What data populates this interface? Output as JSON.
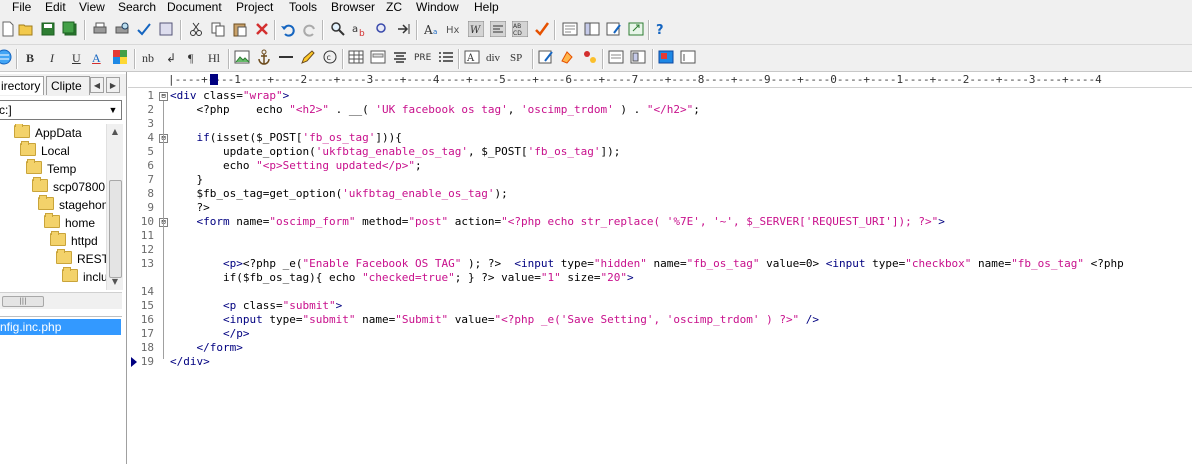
{
  "menu": [
    "File",
    "Edit",
    "View",
    "Search",
    "Document",
    "Project",
    "Tools",
    "Browser",
    "ZC",
    "Window",
    "Help"
  ],
  "toolbar1": [
    "new-file-icon",
    "open-folder-icon",
    "save-icon",
    "save-all-icon",
    "print-icon",
    "print-preview-icon",
    "spellcheck-icon",
    "find-in-files-icon",
    "cut-icon",
    "copy-icon",
    "paste-icon",
    "delete-icon",
    "undo-icon",
    "redo-icon",
    "find-icon",
    "replace-icon",
    "find-next-icon",
    "goto-line-icon",
    "font-size-icon",
    "hex-icon",
    "word-wrap-icon",
    "show-whitespace-icon",
    "line-numbers-icon",
    "syntax-check-icon",
    "browser-preview-icon",
    "toggle-panel-icon",
    "edit-template-icon",
    "external-preview-icon",
    "help-query-icon"
  ],
  "toolbar2": {
    "icons": [
      "globe-icon",
      "image-icon",
      "anchor-icon",
      "hr-icon",
      "pencil-icon",
      "copyright-icon",
      "table-icon",
      "form-icon",
      "align-icon",
      "tag-edit-icon",
      "tag-clear-icon",
      "color-picker-icon",
      "list-view-icon",
      "grid-view-icon",
      "insert-frame-icon",
      "object-icon"
    ],
    "labels": {
      "bold": "B",
      "italic": "I",
      "underline": "U",
      "font": "A",
      "nbsp": "nb",
      "br": "↲",
      "para": "¶",
      "heading": "Hl",
      "pre": "PRE",
      "div": "div",
      "span": "SP"
    }
  },
  "left_panel": {
    "tabs": [
      "irectory",
      "Clipte"
    ],
    "drive": "c:]",
    "tree": [
      {
        "label": "AppData",
        "indent": 14
      },
      {
        "label": "Local",
        "indent": 20
      },
      {
        "label": "Temp",
        "indent": 26
      },
      {
        "label": "scp07800",
        "indent": 32
      },
      {
        "label": "stagehom",
        "indent": 38
      },
      {
        "label": "home",
        "indent": 44
      },
      {
        "label": "httpd",
        "indent": 50
      },
      {
        "label": "RESTVI",
        "indent": 56
      },
      {
        "label": "incluc",
        "indent": 62
      }
    ],
    "hscroll_thumb": "|||",
    "selected_file": "nfig.inc.php"
  },
  "editor": {
    "ruler": "|----+----1----+----2----+----3----+----4----+----5----+----6----+----7----+----8----+----9----+----0----+----1----+----2----+----3----+----4",
    "lines": [
      {
        "n": "1",
        "fold": "⊟",
        "parts": [
          [
            "k",
            "<div "
          ],
          [
            "",
            "class="
          ],
          [
            "s",
            "\"wrap\""
          ],
          [
            "k",
            ">"
          ]
        ]
      },
      {
        "n": "2",
        "fold": "",
        "parts": [
          [
            "",
            "    <?php    echo "
          ],
          [
            "s",
            "\"<h2>\""
          ],
          [
            "",
            " . __( "
          ],
          [
            "s",
            "'UK facebook os tag'"
          ],
          [
            "",
            ", "
          ],
          [
            "s",
            "'oscimp_trdom'"
          ],
          [
            "",
            " ) . "
          ],
          [
            "s",
            "\"</h2>\""
          ],
          [
            "",
            ";"
          ]
        ]
      },
      {
        "n": "3",
        "fold": "",
        "parts": []
      },
      {
        "n": "4",
        "fold": "⊟",
        "parts": [
          [
            "",
            "    "
          ],
          [
            "k",
            "if"
          ],
          [
            "",
            "(isset($_POST["
          ],
          [
            "s",
            "'fb_os_tag'"
          ],
          [
            "",
            "])){"
          ]
        ]
      },
      {
        "n": "5",
        "fold": "",
        "parts": [
          [
            "",
            "        update_option("
          ],
          [
            "s",
            "'ukfbtag_enable_os_tag'"
          ],
          [
            "",
            ", $_POST["
          ],
          [
            "s",
            "'fb_os_tag'"
          ],
          [
            "",
            "]);"
          ]
        ]
      },
      {
        "n": "6",
        "fold": "",
        "parts": [
          [
            "",
            "        echo "
          ],
          [
            "s",
            "\"<p>Setting updated</p>\""
          ],
          [
            "",
            ";"
          ]
        ]
      },
      {
        "n": "7",
        "fold": "",
        "parts": [
          [
            "",
            "    }"
          ]
        ]
      },
      {
        "n": "8",
        "fold": "",
        "parts": [
          [
            "",
            "    $fb_os_tag=get_option("
          ],
          [
            "s",
            "'ukfbtag_enable_os_tag'"
          ],
          [
            "",
            ");"
          ]
        ]
      },
      {
        "n": "9",
        "fold": "",
        "parts": [
          [
            "",
            "    ?>"
          ]
        ]
      },
      {
        "n": "10",
        "fold": "⊟",
        "parts": [
          [
            "k",
            "    <form "
          ],
          [
            "",
            "name="
          ],
          [
            "s",
            "\"oscimp_form\""
          ],
          [
            "",
            " method="
          ],
          [
            "s",
            "\"post\""
          ],
          [
            "",
            " action="
          ],
          [
            "s",
            "\"<?php echo str_replace( '%7E', '~', $_SERVER['REQUEST_URI']); ?>\""
          ],
          [
            "k",
            ">"
          ]
        ]
      },
      {
        "n": "11",
        "fold": "",
        "parts": []
      },
      {
        "n": "12",
        "fold": "",
        "parts": []
      },
      {
        "n": "13",
        "fold": "",
        "parts": [
          [
            "k",
            "        <p>"
          ],
          [
            "",
            "<?php _e("
          ],
          [
            "s",
            "\"Enable Facebook OS TAG\""
          ],
          [
            "",
            " ); ?>  "
          ],
          [
            "k",
            "<input "
          ],
          [
            "",
            "type="
          ],
          [
            "s",
            "\"hidden\""
          ],
          [
            "",
            " name="
          ],
          [
            "s",
            "\"fb_os_tag\""
          ],
          [
            "",
            " value=0> "
          ],
          [
            "k",
            "<input "
          ],
          [
            "",
            "type="
          ],
          [
            "s",
            "\"checkbox\""
          ],
          [
            "",
            " name="
          ],
          [
            "s",
            "\"fb_os_tag\""
          ],
          [
            "",
            " <?php"
          ]
        ]
      },
      {
        "n": "",
        "fold": "",
        "parts": [
          [
            "",
            "        if($fb_os_tag){ echo "
          ],
          [
            "s",
            "\"checked=true\""
          ],
          [
            "",
            "; } ?> value="
          ],
          [
            "s",
            "\"1\""
          ],
          [
            "",
            " size="
          ],
          [
            "s",
            "\"20\""
          ],
          [
            "k",
            ">"
          ]
        ]
      },
      {
        "n": "14",
        "fold": "",
        "parts": []
      },
      {
        "n": "15",
        "fold": "",
        "parts": [
          [
            "k",
            "        <p "
          ],
          [
            "",
            "class="
          ],
          [
            "s",
            "\"submit\""
          ],
          [
            "k",
            ">"
          ]
        ]
      },
      {
        "n": "16",
        "fold": "",
        "parts": [
          [
            "k",
            "        <input "
          ],
          [
            "",
            "type="
          ],
          [
            "s",
            "\"submit\""
          ],
          [
            "",
            " name="
          ],
          [
            "s",
            "\"Submit\""
          ],
          [
            "",
            " value="
          ],
          [
            "s",
            "\"<?php _e('Save Setting', 'oscimp_trdom' ) ?>\""
          ],
          [
            "k",
            " />"
          ]
        ]
      },
      {
        "n": "17",
        "fold": "",
        "parts": [
          [
            "k",
            "        </p>"
          ]
        ]
      },
      {
        "n": "18",
        "fold": "",
        "parts": [
          [
            "k",
            "    </form>"
          ]
        ]
      },
      {
        "n": "19",
        "fold": "",
        "parts": [
          [
            "k",
            "</div>"
          ]
        ]
      }
    ]
  }
}
